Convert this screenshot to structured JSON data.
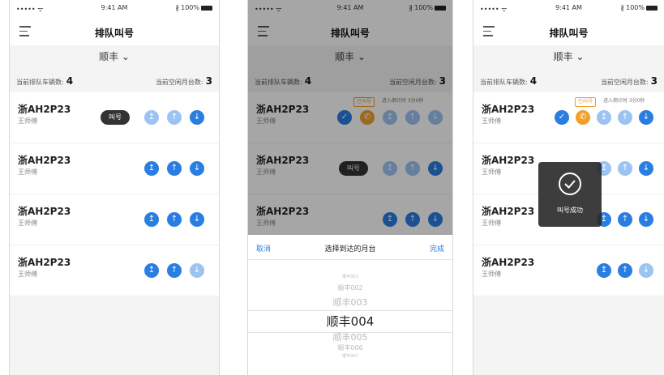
{
  "status": {
    "carrier_signal": "••••• ᯤ",
    "time": "9:41 AM",
    "battery": "∦ 100%"
  },
  "nav": {
    "title": "排队叫号"
  },
  "dropdown": {
    "label": "顺丰 ⌄"
  },
  "stats": {
    "queue_label": "当前排队车辆数:",
    "queue_count": "4",
    "idle_label": "当前空闲月台数:",
    "idle_count": "3"
  },
  "rows": [
    {
      "plate": "浙AH2P23",
      "driver": "王师傅"
    },
    {
      "plate": "浙AH2P23",
      "driver": "王师傅"
    },
    {
      "plate": "浙AH2P23",
      "driver": "王师傅"
    },
    {
      "plate": "浙AH2P23",
      "driver": "王师傅"
    }
  ],
  "call_label": "叫号",
  "tag_called": "已叫号",
  "tag_timer": "进入倒计时 3分0秒",
  "icons": {
    "top": "↥",
    "up": "↑",
    "down": "↓",
    "check": "✓",
    "phone": "✆"
  },
  "picker": {
    "cancel": "取消",
    "title": "选择到达的月台",
    "done": "完成",
    "options": [
      "顺丰001",
      "顺丰002",
      "顺丰003",
      "顺丰004",
      "顺丰005",
      "顺丰006",
      "顺丰007"
    ]
  },
  "toast": {
    "message": "叫号成功"
  },
  "colors": {
    "primary": "#2a7de1",
    "light": "#9cc4f2",
    "orange": "#f2a02c",
    "dark_pill": "#333333"
  }
}
